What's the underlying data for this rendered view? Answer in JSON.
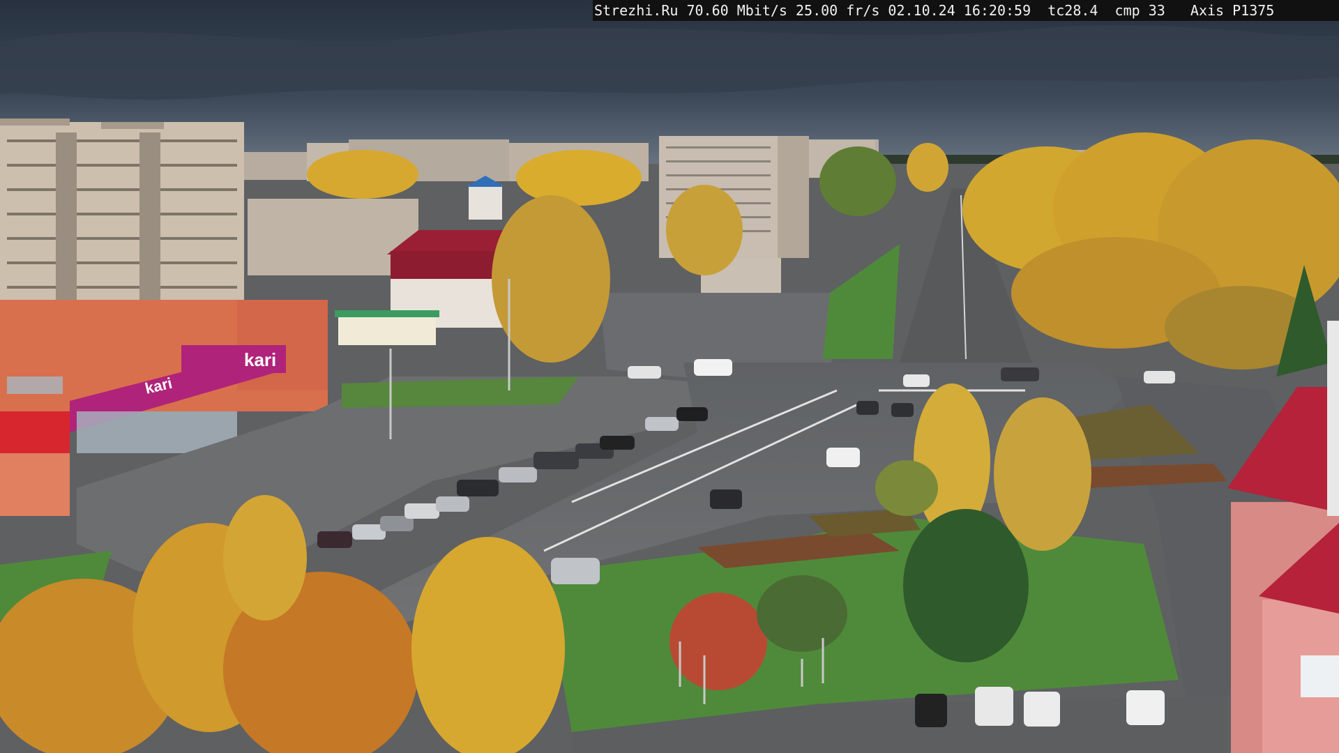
{
  "osd": {
    "text": "Strezhi.Ru 70.60 Mbit/s 25.00 fr/s 02.10.24 16:20:59  tc28.4  cmp 33   Axis P1375"
  },
  "signs": {
    "store_logo": "kari",
    "store_logo_lower": "kari"
  },
  "colors": {
    "sky_top": "#2a3442",
    "sky_bottom": "#5d6b7b",
    "autumn_yellow": "#d6a830",
    "autumn_orange": "#c98a2a",
    "grass": "#4f8a3a",
    "asphalt": "#6d6f71",
    "store_magenta": "#b0237a",
    "store_facade": "#d8704e",
    "roof_red": "#b5223a"
  }
}
